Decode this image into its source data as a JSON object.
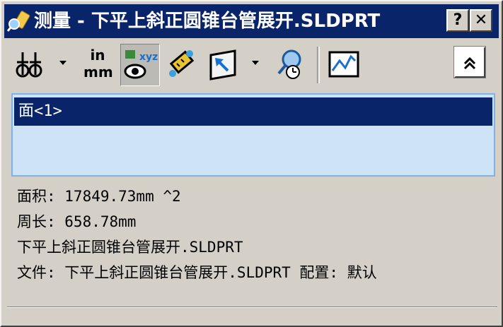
{
  "window": {
    "title": "测量 - 下平上斜正圆锥台管展开.SLDPRT",
    "help_label": "?",
    "close_label": "✕"
  },
  "toolbar": {
    "units_top": "in",
    "units_bottom": "mm",
    "xyz_label": "xyz",
    "collapse_label": "^"
  },
  "selection_list": {
    "items": [
      "面<1>"
    ]
  },
  "results": {
    "area": "面积: 17849.73mm ^2",
    "perimeter": "周长: 658.78mm",
    "part_name": "下平上斜正圆锥台管展开.SLDPRT",
    "file_config": "文件: 下平上斜正圆锥台管展开.SLDPRT 配置: 默认"
  },
  "colors": {
    "title_bg": "#0a246a",
    "window_bg": "#d4d0c8",
    "list_bg": "#cfe3f7",
    "selected_bg": "#0a246a"
  }
}
